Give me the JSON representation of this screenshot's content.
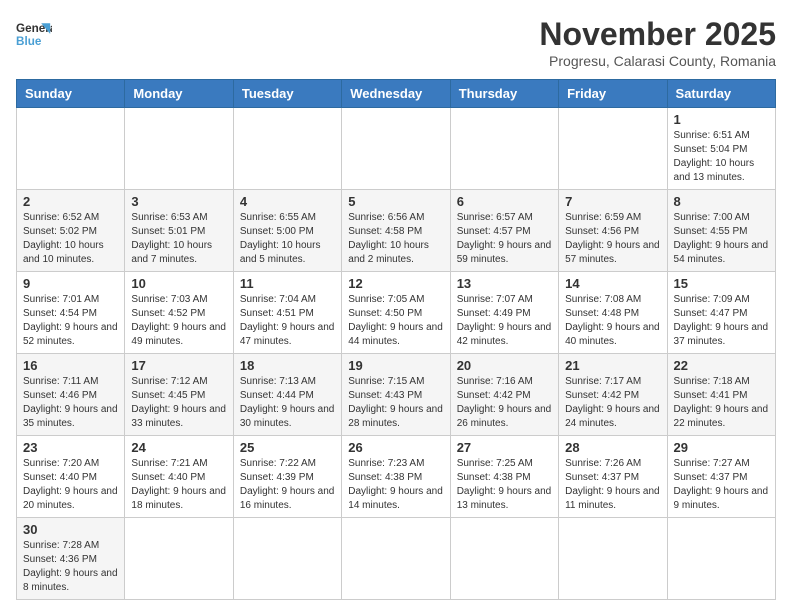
{
  "header": {
    "logo_general": "General",
    "logo_blue": "Blue",
    "month": "November 2025",
    "location": "Progresu, Calarasi County, Romania"
  },
  "days_of_week": [
    "Sunday",
    "Monday",
    "Tuesday",
    "Wednesday",
    "Thursday",
    "Friday",
    "Saturday"
  ],
  "weeks": [
    {
      "days": [
        {
          "num": "",
          "info": ""
        },
        {
          "num": "",
          "info": ""
        },
        {
          "num": "",
          "info": ""
        },
        {
          "num": "",
          "info": ""
        },
        {
          "num": "",
          "info": ""
        },
        {
          "num": "",
          "info": ""
        },
        {
          "num": "1",
          "info": "Sunrise: 6:51 AM\nSunset: 5:04 PM\nDaylight: 10 hours\nand 13 minutes."
        }
      ]
    },
    {
      "days": [
        {
          "num": "2",
          "info": "Sunrise: 6:52 AM\nSunset: 5:02 PM\nDaylight: 10 hours\nand 10 minutes."
        },
        {
          "num": "3",
          "info": "Sunrise: 6:53 AM\nSunset: 5:01 PM\nDaylight: 10 hours\nand 7 minutes."
        },
        {
          "num": "4",
          "info": "Sunrise: 6:55 AM\nSunset: 5:00 PM\nDaylight: 10 hours\nand 5 minutes."
        },
        {
          "num": "5",
          "info": "Sunrise: 6:56 AM\nSunset: 4:58 PM\nDaylight: 10 hours\nand 2 minutes."
        },
        {
          "num": "6",
          "info": "Sunrise: 6:57 AM\nSunset: 4:57 PM\nDaylight: 9 hours\nand 59 minutes."
        },
        {
          "num": "7",
          "info": "Sunrise: 6:59 AM\nSunset: 4:56 PM\nDaylight: 9 hours\nand 57 minutes."
        },
        {
          "num": "8",
          "info": "Sunrise: 7:00 AM\nSunset: 4:55 PM\nDaylight: 9 hours\nand 54 minutes."
        }
      ]
    },
    {
      "days": [
        {
          "num": "9",
          "info": "Sunrise: 7:01 AM\nSunset: 4:54 PM\nDaylight: 9 hours\nand 52 minutes."
        },
        {
          "num": "10",
          "info": "Sunrise: 7:03 AM\nSunset: 4:52 PM\nDaylight: 9 hours\nand 49 minutes."
        },
        {
          "num": "11",
          "info": "Sunrise: 7:04 AM\nSunset: 4:51 PM\nDaylight: 9 hours\nand 47 minutes."
        },
        {
          "num": "12",
          "info": "Sunrise: 7:05 AM\nSunset: 4:50 PM\nDaylight: 9 hours\nand 44 minutes."
        },
        {
          "num": "13",
          "info": "Sunrise: 7:07 AM\nSunset: 4:49 PM\nDaylight: 9 hours\nand 42 minutes."
        },
        {
          "num": "14",
          "info": "Sunrise: 7:08 AM\nSunset: 4:48 PM\nDaylight: 9 hours\nand 40 minutes."
        },
        {
          "num": "15",
          "info": "Sunrise: 7:09 AM\nSunset: 4:47 PM\nDaylight: 9 hours\nand 37 minutes."
        }
      ]
    },
    {
      "days": [
        {
          "num": "16",
          "info": "Sunrise: 7:11 AM\nSunset: 4:46 PM\nDaylight: 9 hours\nand 35 minutes."
        },
        {
          "num": "17",
          "info": "Sunrise: 7:12 AM\nSunset: 4:45 PM\nDaylight: 9 hours\nand 33 minutes."
        },
        {
          "num": "18",
          "info": "Sunrise: 7:13 AM\nSunset: 4:44 PM\nDaylight: 9 hours\nand 30 minutes."
        },
        {
          "num": "19",
          "info": "Sunrise: 7:15 AM\nSunset: 4:43 PM\nDaylight: 9 hours\nand 28 minutes."
        },
        {
          "num": "20",
          "info": "Sunrise: 7:16 AM\nSunset: 4:42 PM\nDaylight: 9 hours\nand 26 minutes."
        },
        {
          "num": "21",
          "info": "Sunrise: 7:17 AM\nSunset: 4:42 PM\nDaylight: 9 hours\nand 24 minutes."
        },
        {
          "num": "22",
          "info": "Sunrise: 7:18 AM\nSunset: 4:41 PM\nDaylight: 9 hours\nand 22 minutes."
        }
      ]
    },
    {
      "days": [
        {
          "num": "23",
          "info": "Sunrise: 7:20 AM\nSunset: 4:40 PM\nDaylight: 9 hours\nand 20 minutes."
        },
        {
          "num": "24",
          "info": "Sunrise: 7:21 AM\nSunset: 4:40 PM\nDaylight: 9 hours\nand 18 minutes."
        },
        {
          "num": "25",
          "info": "Sunrise: 7:22 AM\nSunset: 4:39 PM\nDaylight: 9 hours\nand 16 minutes."
        },
        {
          "num": "26",
          "info": "Sunrise: 7:23 AM\nSunset: 4:38 PM\nDaylight: 9 hours\nand 14 minutes."
        },
        {
          "num": "27",
          "info": "Sunrise: 7:25 AM\nSunset: 4:38 PM\nDaylight: 9 hours\nand 13 minutes."
        },
        {
          "num": "28",
          "info": "Sunrise: 7:26 AM\nSunset: 4:37 PM\nDaylight: 9 hours\nand 11 minutes."
        },
        {
          "num": "29",
          "info": "Sunrise: 7:27 AM\nSunset: 4:37 PM\nDaylight: 9 hours\nand 9 minutes."
        }
      ]
    },
    {
      "days": [
        {
          "num": "30",
          "info": "Sunrise: 7:28 AM\nSunset: 4:36 PM\nDaylight: 9 hours\nand 8 minutes."
        },
        {
          "num": "",
          "info": ""
        },
        {
          "num": "",
          "info": ""
        },
        {
          "num": "",
          "info": ""
        },
        {
          "num": "",
          "info": ""
        },
        {
          "num": "",
          "info": ""
        },
        {
          "num": "",
          "info": ""
        }
      ]
    }
  ]
}
